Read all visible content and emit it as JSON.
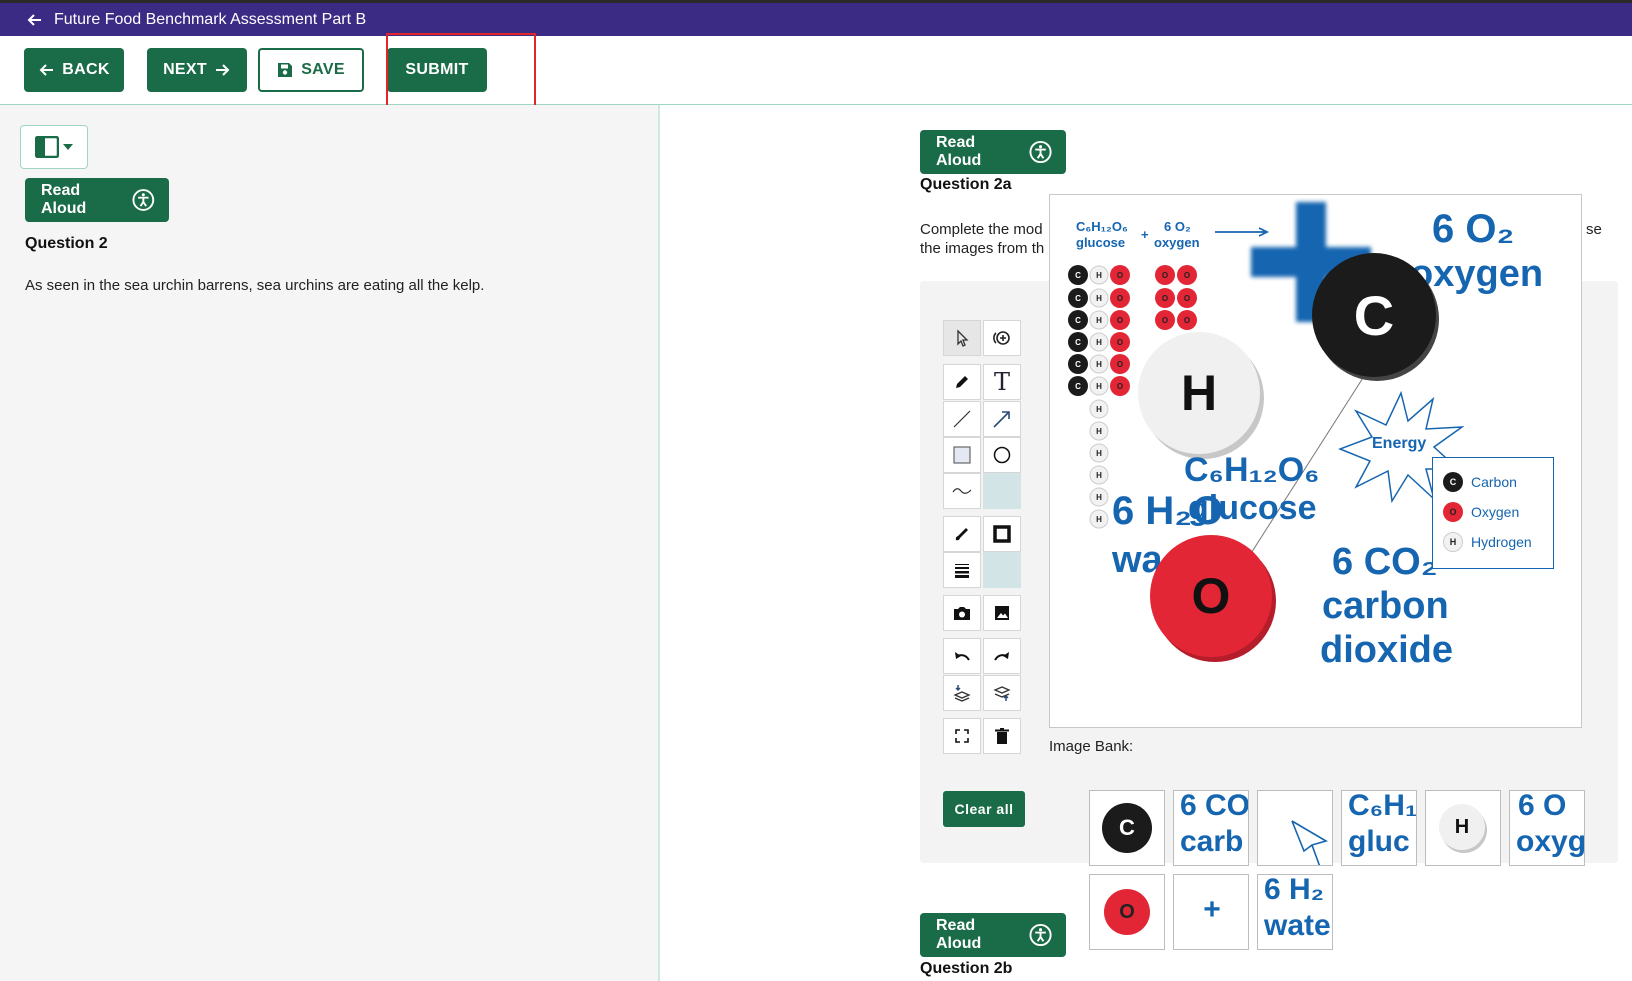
{
  "header": {
    "title": "Future Food Benchmark Assessment Part B"
  },
  "toolbar": {
    "back_label": "BACK",
    "next_label": "NEXT",
    "save_label": "SAVE",
    "submit_label": "SUBMIT"
  },
  "left": {
    "read_aloud": "Read Aloud",
    "question_title": "Question 2",
    "question_text": "As seen in the sea urchin barrens, sea urchins are eating all the kelp."
  },
  "right": {
    "read_aloud": "Read Aloud",
    "question_title": "Question 2a",
    "instruction_line1": "Complete the mod",
    "instruction_line1_end": "se",
    "instruction_line2": "the images from th",
    "clear_all": "Clear all",
    "image_bank_label": "Image Bank:",
    "read_aloud_2": "Read Aloud",
    "question_title_2": "Question 2b"
  },
  "canvas": {
    "small_eq_left_formula": "C₆H₁₂O₆",
    "small_eq_left_name": "glucose",
    "small_eq_plus": "+",
    "small_eq_right_formula": "6 O₂",
    "small_eq_right_name": "oxygen",
    "big_o2_formula": "6 O₂",
    "big_o2_name": "oxygen",
    "atom_c": "C",
    "atom_h": "H",
    "atom_o": "O",
    "glucose_formula": "C₆H₁₂O₆",
    "glucose_name": "glucose",
    "water_formula": "6 H₂O",
    "water_name": "wa",
    "co2_formula": "6 CO₂",
    "co2_name_1": "carbon",
    "co2_name_2": "dioxide",
    "energy_label": "Energy",
    "legend": [
      {
        "symbol": "C",
        "label": "Carbon",
        "color": "#1b1b1b"
      },
      {
        "symbol": "O",
        "label": "Oxygen",
        "color": "#e32636"
      },
      {
        "symbol": "H",
        "label": "Hydrogen",
        "color": "#f2f2f2"
      }
    ]
  },
  "image_bank": {
    "row1": [
      {
        "type": "atom",
        "text": "C"
      },
      {
        "type": "text",
        "line1": "6 CO",
        "line2": "carb"
      },
      {
        "type": "arrow"
      },
      {
        "type": "text",
        "line1": "C₆H₁",
        "line2": "gluc"
      },
      {
        "type": "atom",
        "text": "H"
      },
      {
        "type": "text",
        "line1": "6 O",
        "line2": "oxyg"
      }
    ],
    "row2": [
      {
        "type": "atom",
        "text": "O"
      },
      {
        "type": "text",
        "line1": "+",
        "line2": ""
      },
      {
        "type": "text",
        "line1": "6 H₂",
        "line2": "wate"
      }
    ]
  },
  "colors": {
    "brand_green": "#1a6b47",
    "header_purple": "#3c2b84",
    "molecule_blue": "#1565b0",
    "highlight_red": "#e0262a"
  }
}
